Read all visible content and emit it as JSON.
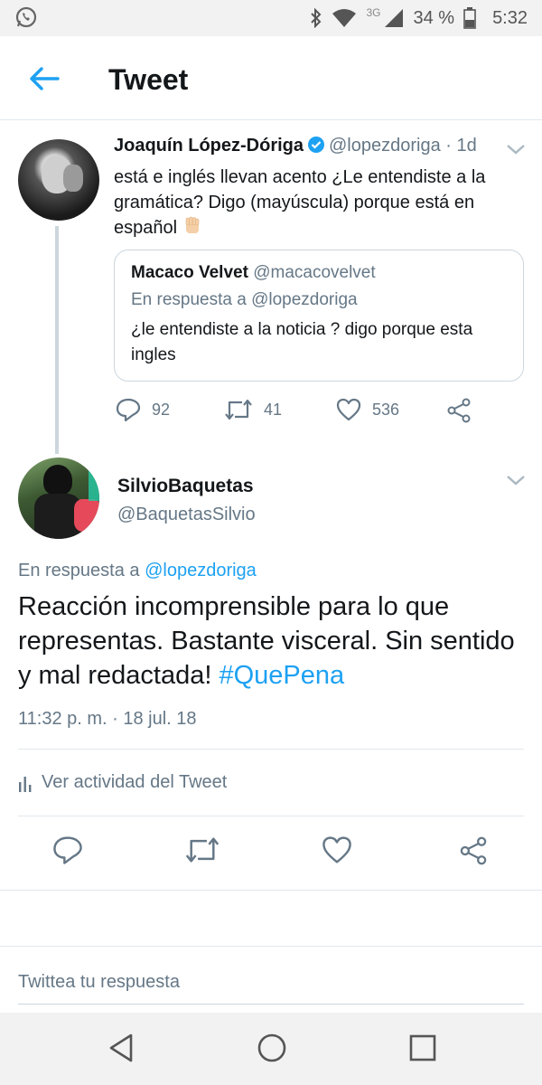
{
  "status_bar": {
    "network": "3G",
    "battery": "34 %",
    "time": "5:32",
    "icons": [
      "whatsapp-icon",
      "bluetooth-icon",
      "wifi-icon",
      "signal-icon",
      "battery-icon"
    ]
  },
  "header": {
    "title": "Tweet"
  },
  "quoted_parent": {
    "name": "Joaquín López-Dóriga",
    "handle": "@lopezdoriga",
    "time": "· 1d",
    "text": "está e inglés llevan acento ¿Le entendiste a la gramática? Digo (mayúscula) porque está en español",
    "emoji": "raised-fist",
    "quote": {
      "name": "Macaco Velvet",
      "handle": "@macacovelvet",
      "reply_prefix": "En respuesta a",
      "reply_to": "@lopezdoriga",
      "text": "¿le entendiste a la noticia ? digo porque esta ingles"
    },
    "replies": "92",
    "retweets": "41",
    "likes": "536"
  },
  "tweet": {
    "name": "SilvioBaquetas",
    "handle": "@BaquetasSilvio",
    "reply_prefix": "En respuesta a",
    "reply_to": "@lopezdoriga",
    "text": "Reacción incomprensible para lo que representas. Bastante visceral. Sin sentido y mal redactada!",
    "hashtag": "#QuePena",
    "timestamp": "11:32 p. m. · 18 jul. 18",
    "activity_label": "Ver actividad del Tweet"
  },
  "reply_box": {
    "placeholder": "Twittea tu respuesta"
  },
  "colors": {
    "accent": "#1da1f2",
    "secondary_text": "#657786",
    "border": "#e1e8ed"
  }
}
